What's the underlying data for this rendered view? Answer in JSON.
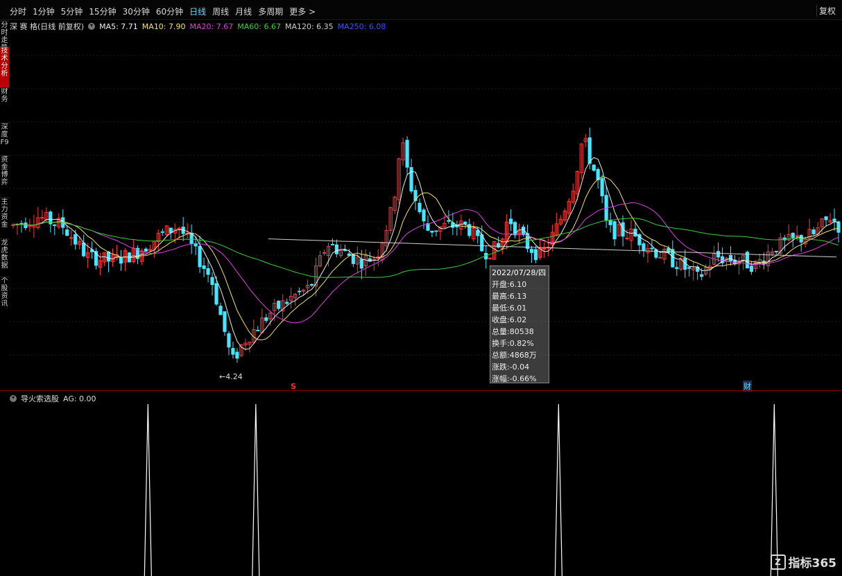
{
  "topbar": {
    "tabs": [
      {
        "label": "分时",
        "active": false
      },
      {
        "label": "1分钟",
        "active": false
      },
      {
        "label": "5分钟",
        "active": false
      },
      {
        "label": "15分钟",
        "active": false
      },
      {
        "label": "30分钟",
        "active": false
      },
      {
        "label": "60分钟",
        "active": false
      },
      {
        "label": "日线",
        "active": true
      },
      {
        "label": "周线",
        "active": false
      },
      {
        "label": "月线",
        "active": false
      },
      {
        "label": "多周期",
        "active": false
      },
      {
        "label": "更多 >",
        "active": false
      }
    ],
    "restore_label": "复权"
  },
  "sidebar": {
    "items": [
      {
        "label": "分时走势",
        "active": false
      },
      {
        "label": "技术分析",
        "active": true
      },
      {
        "label": "财务",
        "active": false
      },
      {
        "label": "深度F9",
        "active": false
      },
      {
        "label": "资金博弈",
        "active": false
      },
      {
        "label": "主力资金",
        "active": false
      },
      {
        "label": "龙虎数据",
        "active": false
      },
      {
        "label": "个股资讯",
        "active": false
      }
    ]
  },
  "legend": {
    "stock": "深 赛 格(日线 前复权)",
    "ma": [
      {
        "label": "MA5: 7.71",
        "color": "#f0f0f0"
      },
      {
        "label": "MA10: 7.90",
        "color": "#f5e26a"
      },
      {
        "label": "MA20: 7.67",
        "color": "#e040e0"
      },
      {
        "label": "MA60: 6.67",
        "color": "#3ccf3c"
      },
      {
        "label": "MA120: 6.35",
        "color": "#d0d0d0"
      },
      {
        "label": "MA250: 6.08",
        "color": "#3355ff"
      }
    ]
  },
  "tooltip": {
    "date": "2022/07/28/四",
    "lines": [
      "开盘:6.10",
      "最高:6.13",
      "最低:6.01",
      "收盘:6.02",
      "总量:80538",
      "换手:0.82%",
      "总额:4868万",
      "涨跌:-0.04",
      "涨幅:-0.66%"
    ]
  },
  "indicator": {
    "name": "导火索选股",
    "value": "AG: 0.00"
  },
  "markers": {
    "min_label": "←4.24",
    "s_label": "S",
    "cai_label": "财"
  },
  "logo": {
    "text": "指标365",
    "icon": "Z"
  },
  "chart_data": {
    "type": "candlestick",
    "price_range": [
      4.0,
      12.0
    ],
    "colors": {
      "up": "#ff3a3a",
      "down": "#48e5ff",
      "ma5": "#f0f0f0",
      "ma10": "#f5e26a",
      "ma20": "#e040e0",
      "ma60": "#3ccf3c",
      "ma120": "#d0d0d0",
      "signal": "#ffffff"
    },
    "min_price": 4.24,
    "signal_positions": [
      0.165,
      0.295,
      0.66,
      0.92
    ]
  }
}
